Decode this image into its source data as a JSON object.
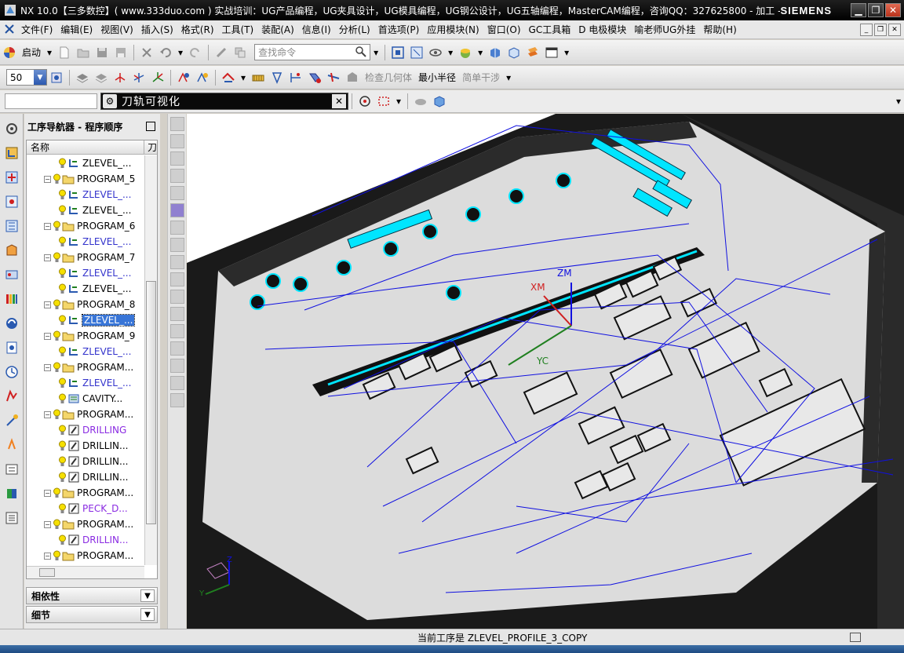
{
  "window": {
    "title": "NX 10.0【三多数控】( www.333duo.com ) 实战培训：UG产品编程，UG夹具设计，UG模具编程，UG钢公设计，UG五轴编程，MasterCAM编程，咨询QQ：327625800 - 加工 -...",
    "brand": "SIEMENS"
  },
  "menu": [
    "文件(F)",
    "编辑(E)",
    "视图(V)",
    "插入(S)",
    "格式(R)",
    "工具(T)",
    "装配(A)",
    "信息(I)",
    "分析(L)",
    "首选项(P)",
    "应用模块(N)",
    "窗口(O)",
    "GC工具箱",
    "D 电极模块",
    "喻老师UG外挂",
    "帮助(H)"
  ],
  "toolbar1": {
    "start_label": "启动",
    "search_placeholder": "查找命令"
  },
  "toolbar2": {
    "zoom_value": "50",
    "check_geometry": "检查几何体",
    "min_radius": "最小半径",
    "simple_interference": "简单干涉"
  },
  "panel": {
    "title": "刀轨可视化"
  },
  "navigator": {
    "title": "工序导航器 - 程序顺序",
    "col_name": "名称",
    "col_tool": "刀",
    "rows": [
      {
        "indent": 2,
        "type": "op-zlevel",
        "label": "ZLEVEL_...",
        "color": "black"
      },
      {
        "indent": 1,
        "type": "program",
        "label": "PROGRAM_5",
        "color": "black"
      },
      {
        "indent": 2,
        "type": "op-zlevel",
        "label": "ZLEVEL_...",
        "color": "blue"
      },
      {
        "indent": 2,
        "type": "op-zlevel",
        "label": "ZLEVEL_...",
        "color": "black"
      },
      {
        "indent": 1,
        "type": "program",
        "label": "PROGRAM_6",
        "color": "black"
      },
      {
        "indent": 2,
        "type": "op-zlevel",
        "label": "ZLEVEL_...",
        "color": "blue"
      },
      {
        "indent": 1,
        "type": "program",
        "label": "PROGRAM_7",
        "color": "black"
      },
      {
        "indent": 2,
        "type": "op-zlevel",
        "label": "ZLEVEL_...",
        "color": "blue"
      },
      {
        "indent": 2,
        "type": "op-zlevel",
        "label": "ZLEVEL_...",
        "color": "black"
      },
      {
        "indent": 1,
        "type": "program",
        "label": "PROGRAM_8",
        "color": "black"
      },
      {
        "indent": 2,
        "type": "op-zlevel",
        "label": "ZLEVEL_...",
        "color": "selected"
      },
      {
        "indent": 1,
        "type": "program",
        "label": "PROGRAM_9",
        "color": "black"
      },
      {
        "indent": 2,
        "type": "op-zlevel",
        "label": "ZLEVEL_...",
        "color": "blue"
      },
      {
        "indent": 1,
        "type": "program",
        "label": "PROGRAM...",
        "color": "black"
      },
      {
        "indent": 2,
        "type": "op-zlevel",
        "label": "ZLEVEL_...",
        "color": "blue"
      },
      {
        "indent": 2,
        "type": "op-cavity",
        "label": "CAVITY...",
        "color": "black"
      },
      {
        "indent": 1,
        "type": "program",
        "label": "PROGRAM...",
        "color": "black"
      },
      {
        "indent": 2,
        "type": "op-drill",
        "label": "DRILLING",
        "color": "purple"
      },
      {
        "indent": 2,
        "type": "op-drill",
        "label": "DRILLIN...",
        "color": "black"
      },
      {
        "indent": 2,
        "type": "op-drill",
        "label": "DRILLIN...",
        "color": "black"
      },
      {
        "indent": 2,
        "type": "op-drill",
        "label": "DRILLIN...",
        "color": "black"
      },
      {
        "indent": 1,
        "type": "program",
        "label": "PROGRAM...",
        "color": "black"
      },
      {
        "indent": 2,
        "type": "op-drill",
        "label": "PECK_D...",
        "color": "purple"
      },
      {
        "indent": 1,
        "type": "program",
        "label": "PROGRAM...",
        "color": "black"
      },
      {
        "indent": 2,
        "type": "op-drill",
        "label": "DRILLIN...",
        "color": "purple"
      },
      {
        "indent": 1,
        "type": "program",
        "label": "PROGRAM...",
        "color": "black"
      }
    ],
    "dependency": "相依性",
    "details": "细节"
  },
  "viewport": {
    "axis_xm": "XM",
    "axis_zm": "ZM",
    "axis_yc": "YC",
    "triad_z": "Z",
    "triad_y": "Y"
  },
  "status": {
    "message": "当前工序是 ZLEVEL_PROFILE_3_COPY"
  },
  "colors": {
    "toolpath": "#1010e0",
    "highlight": "#00e5ff",
    "part_gray": "#dcdcdc",
    "selected": "#3875d7"
  }
}
